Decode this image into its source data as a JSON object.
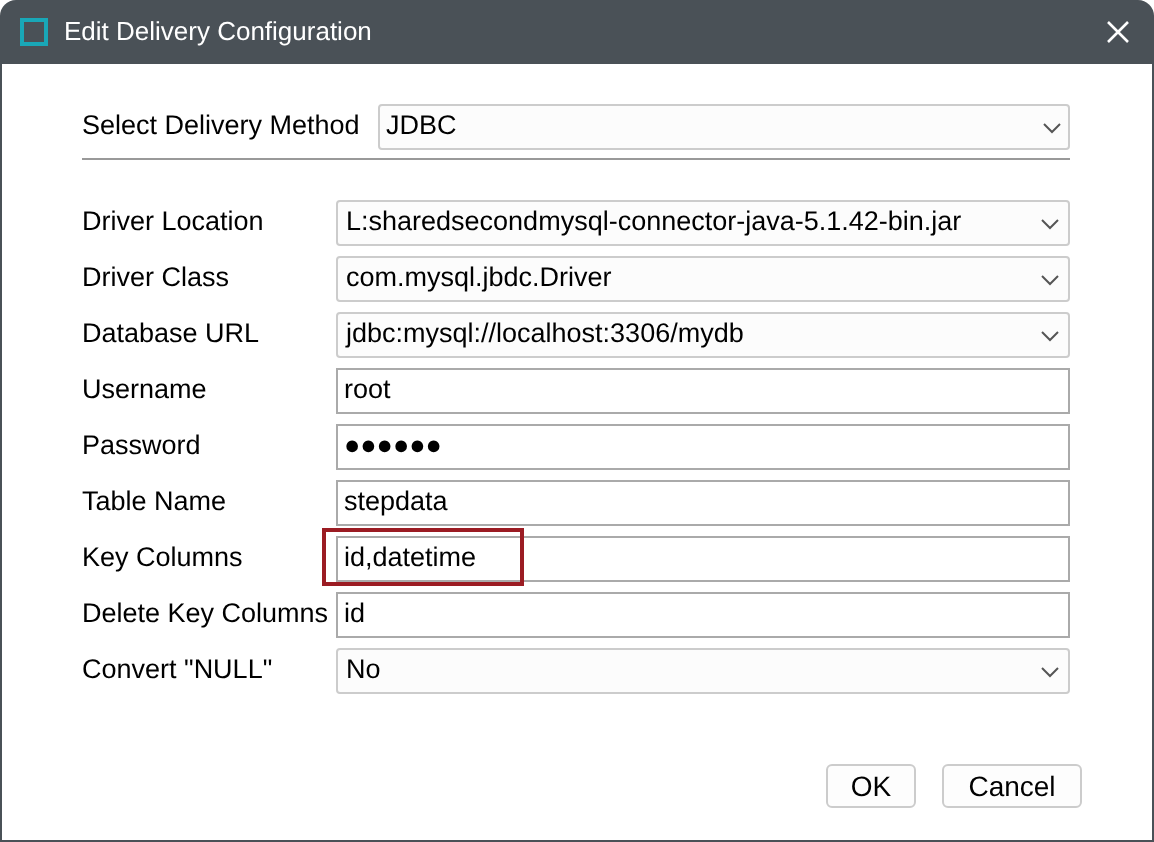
{
  "window": {
    "title": "Edit Delivery Configuration"
  },
  "delivery_method": {
    "label": "Select Delivery Method",
    "value": "JDBC"
  },
  "fields": [
    {
      "label": "Driver Location",
      "kind": "dropdown",
      "value": "L:sharedsecondmysql-connector-java-5.1.42-bin.jar",
      "highlighted": false
    },
    {
      "label": "Driver Class",
      "kind": "dropdown",
      "value": "com.mysql.jbdc.Driver",
      "highlighted": false
    },
    {
      "label": "Database URL",
      "kind": "dropdown",
      "value": "jdbc:mysql://localhost:3306/mydb",
      "highlighted": false
    },
    {
      "label": "Username",
      "kind": "text",
      "value": "root",
      "highlighted": false
    },
    {
      "label": "Password",
      "kind": "text",
      "value": "●●●●●●",
      "highlighted": false
    },
    {
      "label": "Table Name",
      "kind": "text",
      "value": "stepdata",
      "highlighted": false
    },
    {
      "label": "Key Columns",
      "kind": "text",
      "value": "id,datetime",
      "highlighted": true
    },
    {
      "label": "Delete Key Columns",
      "kind": "text",
      "value": "id",
      "highlighted": false
    },
    {
      "label": "Convert \"NULL\"",
      "kind": "dropdown",
      "value": "No",
      "highlighted": false
    }
  ],
  "buttons": [
    "OK",
    "Cancel"
  ]
}
